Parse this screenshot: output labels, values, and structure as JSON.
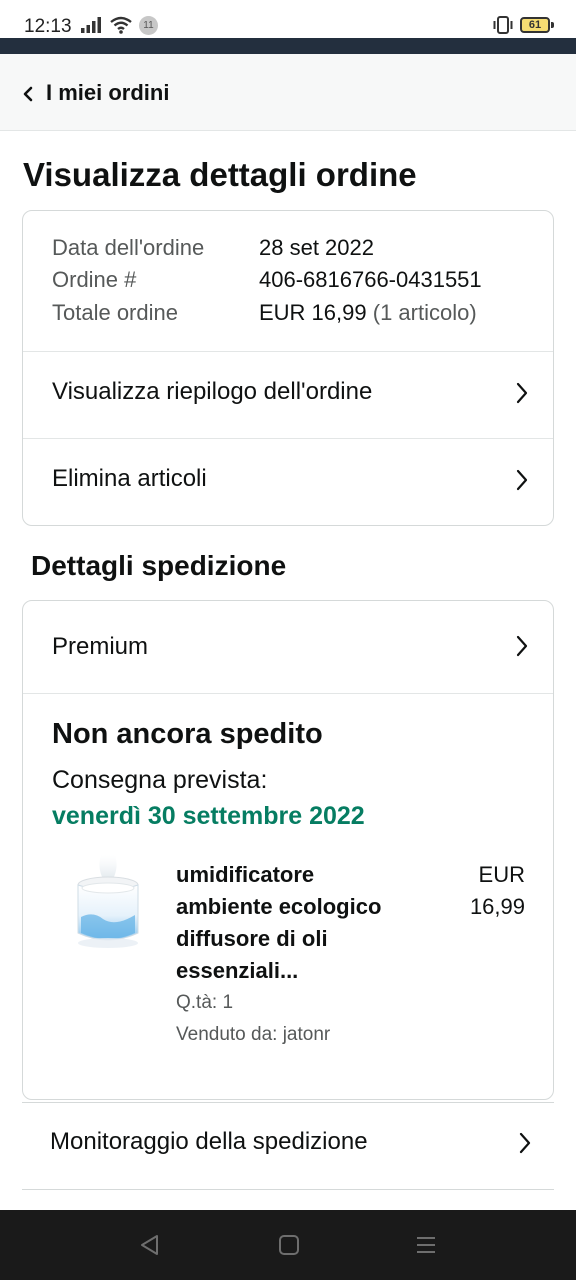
{
  "status_bar": {
    "time": "12:13",
    "notification_count": "11",
    "battery": "61",
    "signal_icon": "signal-bars-icon",
    "wifi_icon": "wifi-icon",
    "vibrate_icon": "vibrate-icon"
  },
  "header": {
    "back_label": "I miei ordini"
  },
  "page": {
    "title": "Visualizza dettagli ordine"
  },
  "order_summary": {
    "rows": [
      {
        "label": "Data dell'ordine",
        "value": "28 set 2022"
      },
      {
        "label": "Ordine #",
        "value": "406-6816766-0431551"
      },
      {
        "label": "Totale ordine",
        "value": "EUR 16,99",
        "extra": "(1 articolo)"
      }
    ],
    "links": [
      {
        "label": "Visualizza riepilogo dell'ordine"
      },
      {
        "label": "Elimina articoli"
      }
    ]
  },
  "shipping": {
    "section_title": "Dettagli spedizione",
    "method": "Premium",
    "status": "Non ancora spedito",
    "eta_label": "Consegna prevista:",
    "eta_date": "venerdì 30 settembre 2022",
    "item": {
      "title": "umidificatore ambiente ecologico diffusore di oli essenziali...",
      "price_currency": "EUR",
      "price_value": "16,99",
      "qty": "Q.tà: 1",
      "seller": "Venduto da: jatonr"
    }
  },
  "tracking": {
    "label": "Monitoraggio della spedizione"
  },
  "colors": {
    "brand_bar": "#232f3e",
    "eta_green": "#067d62",
    "nav_bar": "#1a1a1a"
  }
}
